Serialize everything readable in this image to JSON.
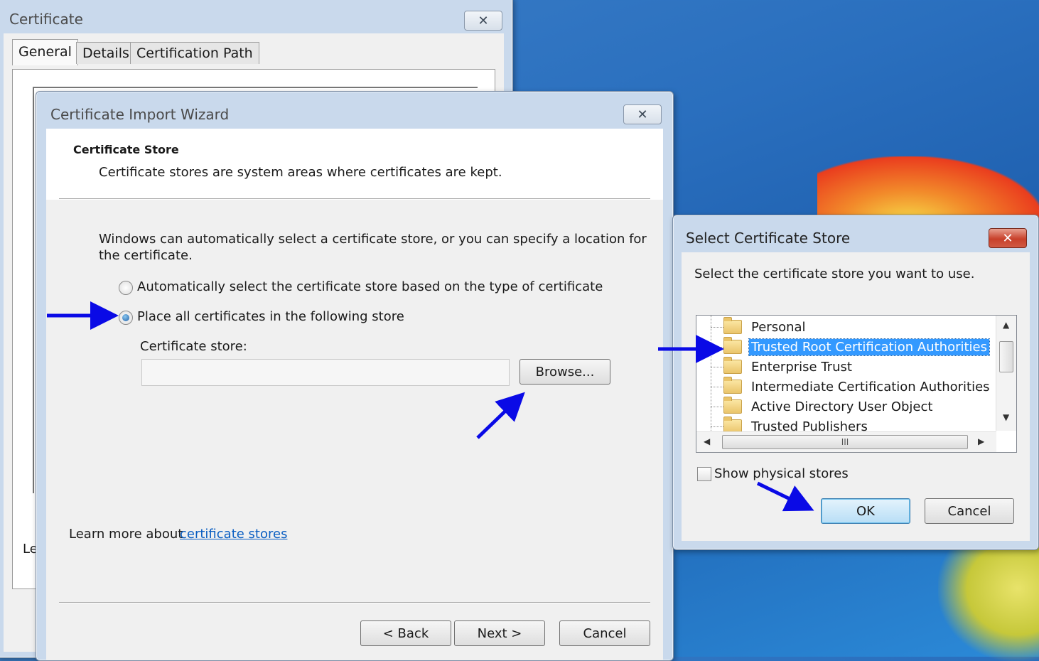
{
  "desktop": {},
  "certificate_window": {
    "title": "Certificate",
    "tabs": [
      "General",
      "Details",
      "Certification Path"
    ],
    "partial_text": "Le"
  },
  "wizard": {
    "title": "Certificate Import Wizard",
    "header_title": "Certificate Store",
    "header_desc": "Certificate stores are system areas where certificates are kept.",
    "intro_line1": "Windows can automatically select a certificate store, or you can specify a location for",
    "intro_line2": "the certificate.",
    "radio_auto": "Automatically select the certificate store based on the type of certificate",
    "radio_place": "Place all certificates in the following store",
    "selected_option": "Place all certificates in the following store",
    "store_label": "Certificate store:",
    "store_value": "",
    "browse_label": "Browse...",
    "learn_more_prefix": "Learn more about ",
    "learn_more_link": "certificate stores",
    "back_label": "< Back",
    "next_label": "Next >",
    "cancel_label": "Cancel"
  },
  "select_store": {
    "title": "Select Certificate Store",
    "prompt": "Select the certificate store you want to use.",
    "stores": [
      "Personal",
      "Trusted Root Certification Authorities",
      "Enterprise Trust",
      "Intermediate Certification Authorities",
      "Active Directory User Object",
      "Trusted Publishers"
    ],
    "selected_store": "Trusted Root Certification Authorities",
    "show_physical_label": "Show physical stores",
    "show_physical_checked": false,
    "ok_label": "OK",
    "cancel_label": "Cancel"
  },
  "colors": {
    "selection": "#3399ff",
    "annotation_arrow": "#0a0ae6",
    "link": "#0a5ec2"
  }
}
